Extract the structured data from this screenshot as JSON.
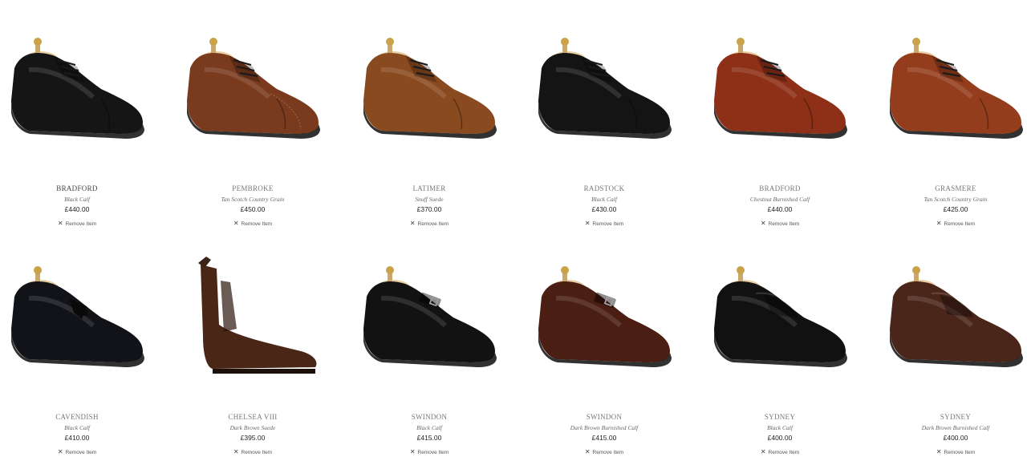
{
  "products": [
    {
      "name": "BRADFORD",
      "material": "Black Calf",
      "price": "£440.00",
      "remove": "Remove Item",
      "color": "#151515",
      "style": "derby"
    },
    {
      "name": "PEMBROKE",
      "material": "Tan Scotch Country Grain",
      "price": "£450.00",
      "remove": "Remove Item",
      "color": "#7a3a1e",
      "style": "brogue"
    },
    {
      "name": "LATIMER",
      "material": "Snuff Suede",
      "price": "£370.00",
      "remove": "Remove Item",
      "color": "#8a4a1f",
      "style": "derby"
    },
    {
      "name": "RADSTOCK",
      "material": "Black Calf",
      "price": "£430.00",
      "remove": "Remove Item",
      "color": "#141414",
      "style": "oxford"
    },
    {
      "name": "BRADFORD",
      "material": "Chestnut Burnished Calf",
      "price": "£440.00",
      "remove": "Remove Item",
      "color": "#8e2f17",
      "style": "derby"
    },
    {
      "name": "GRASMERE",
      "material": "Tan Scotch Country Grain",
      "price": "£425.00",
      "remove": "Remove Item",
      "color": "#933d1d",
      "style": "derby"
    },
    {
      "name": "CAVENDISH",
      "material": "Black Calf",
      "price": "£410.00",
      "remove": "Remove Item",
      "color": "#121318",
      "style": "tassel"
    },
    {
      "name": "CHELSEA VIII",
      "material": "Dark Brown Suede",
      "price": "£395.00",
      "remove": "Remove Item",
      "color": "#4a2616",
      "style": "chelsea"
    },
    {
      "name": "SWINDON",
      "material": "Black Calf",
      "price": "£415.00",
      "remove": "Remove Item",
      "color": "#121212",
      "style": "monk"
    },
    {
      "name": "SWINDON",
      "material": "Dark Brown Burnished Calf",
      "price": "£415.00",
      "remove": "Remove Item",
      "color": "#4a1e12",
      "style": "monk"
    },
    {
      "name": "SYDNEY",
      "material": "Black Calf",
      "price": "£400.00",
      "remove": "Remove Item",
      "color": "#111111",
      "style": "loafer"
    },
    {
      "name": "SYDNEY",
      "material": "Dark Brown Burnished Calf",
      "price": "£400.00",
      "remove": "Remove Item",
      "color": "#4a251a",
      "style": "loafer"
    }
  ]
}
